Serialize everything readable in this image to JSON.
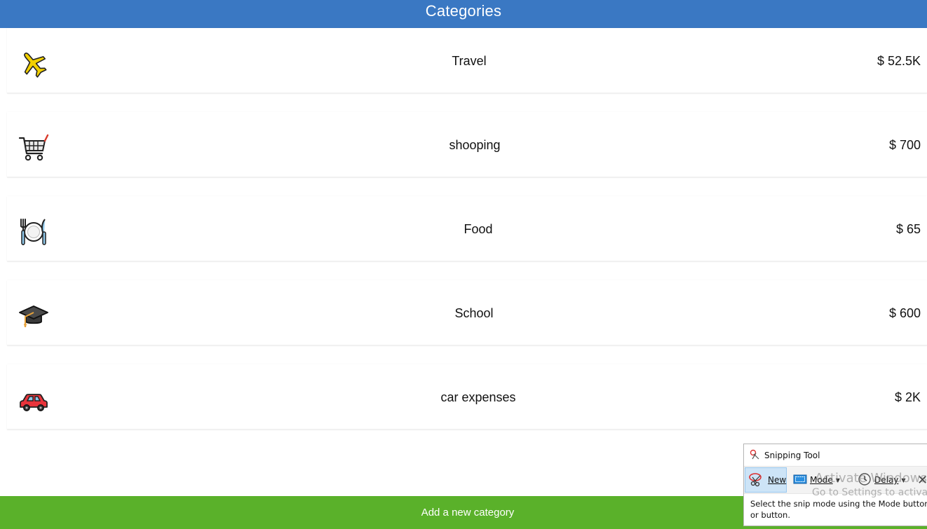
{
  "header": {
    "title": "Categories"
  },
  "categories": [
    {
      "name": "Travel",
      "amount": "$ 52.5K",
      "icon": "airplane-icon"
    },
    {
      "name": "shooping",
      "amount": "$ 700",
      "icon": "shopping-cart-icon"
    },
    {
      "name": "Food",
      "amount": "$ 65",
      "icon": "fork-and-knife-plate-icon"
    },
    {
      "name": "School",
      "amount": "$ 600",
      "icon": "graduation-cap-icon"
    },
    {
      "name": "car expenses",
      "amount": "$ 2K",
      "icon": "car-icon"
    }
  ],
  "footer": {
    "add_label": "Add a new category"
  },
  "snipping_tool": {
    "title": "Snipping Tool",
    "new_label": "New",
    "mode_label": "Mode",
    "delay_label": "Delay",
    "help_text": "Select the snip mode using the Mode button or button."
  },
  "watermark": {
    "line1": "Activate Windows",
    "line2": "Go to Settings to activate"
  },
  "colors": {
    "header_bg": "#3a78c3",
    "footer_bg": "#5ab12a"
  }
}
